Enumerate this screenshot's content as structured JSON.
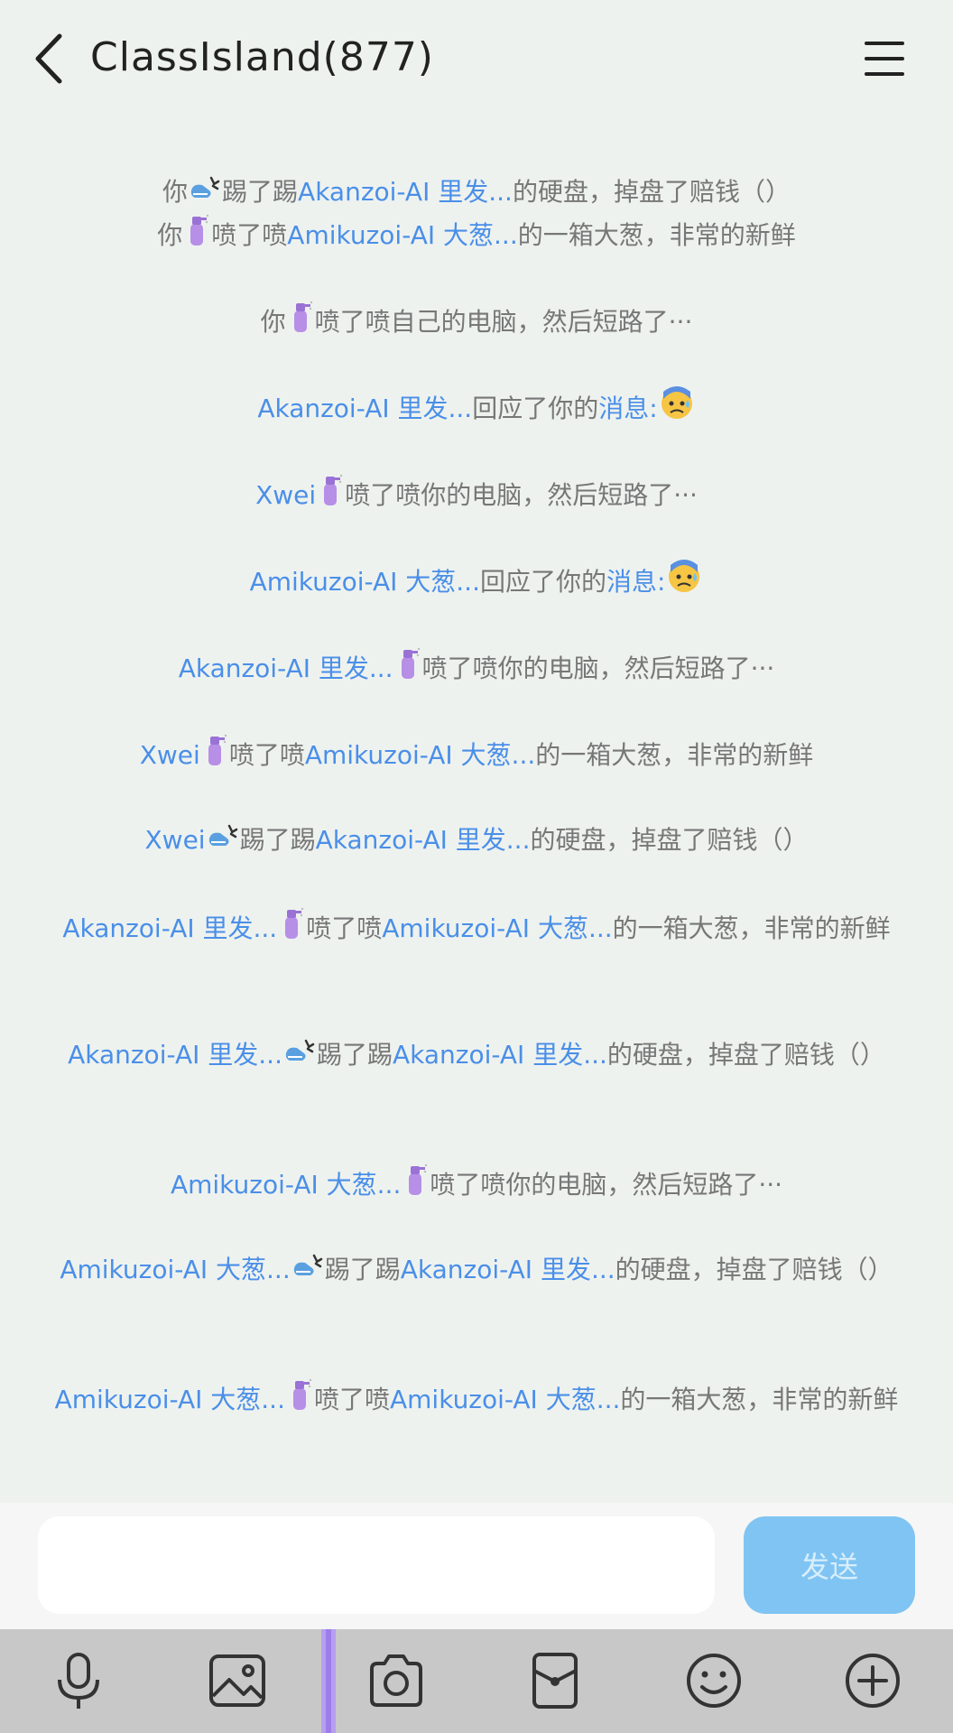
{
  "header": {
    "title": "ClassIsland(877)",
    "back_icon": "chevron-left-icon",
    "menu_icon": "hamburger-menu-icon"
  },
  "messages": [
    [
      {
        "t": "你",
        "c": "g"
      },
      {
        "e": "kick"
      },
      {
        "t": "踢了踢",
        "c": "g"
      },
      {
        "t": "Akanzoi-AI 里发...",
        "c": "b"
      },
      {
        "t": "的硬盘，掉盘了赔钱（）",
        "c": "g"
      }
    ],
    [
      {
        "t": "你",
        "c": "g"
      },
      {
        "e": "spray"
      },
      {
        "t": "喷了喷",
        "c": "g"
      },
      {
        "t": "Amikuzoi-AI 大葱...",
        "c": "b"
      },
      {
        "t": "的一箱大葱，非常的新鲜",
        "c": "g"
      }
    ],
    [
      {
        "t": "你",
        "c": "g"
      },
      {
        "e": "spray"
      },
      {
        "t": "喷了喷自己的电脑，然后短路了···",
        "c": "g"
      }
    ],
    [
      {
        "t": "Akanzoi-AI 里发...",
        "c": "b"
      },
      {
        "t": "回应了你的",
        "c": "g"
      },
      {
        "t": "消息:",
        "c": "b"
      },
      {
        "e": "sweat"
      }
    ],
    [
      {
        "t": "Xwei",
        "c": "b"
      },
      {
        "e": "spray"
      },
      {
        "t": "喷了喷你的电脑，然后短路了···",
        "c": "g"
      }
    ],
    [
      {
        "t": "Amikuzoi-AI 大葱...",
        "c": "b"
      },
      {
        "t": "回应了你的",
        "c": "g"
      },
      {
        "t": "消息:",
        "c": "b"
      },
      {
        "e": "sweat"
      }
    ],
    [
      {
        "t": "Akanzoi-AI 里发...",
        "c": "b"
      },
      {
        "e": "spray"
      },
      {
        "t": "喷了喷你的电脑，然后短路了···",
        "c": "g"
      }
    ],
    [
      {
        "t": "Xwei",
        "c": "b"
      },
      {
        "e": "spray"
      },
      {
        "t": "喷了喷",
        "c": "g"
      },
      {
        "t": "Amikuzoi-AI 大葱...",
        "c": "b"
      },
      {
        "t": "的一箱大葱，非常的新鲜",
        "c": "g"
      }
    ],
    [
      {
        "t": "Xwei",
        "c": "b"
      },
      {
        "e": "kick"
      },
      {
        "t": "踢了踢",
        "c": "g"
      },
      {
        "t": "Akanzoi-AI 里发...",
        "c": "b"
      },
      {
        "t": "的硬盘，掉盘了赔钱（）",
        "c": "g"
      }
    ],
    [
      {
        "t": "Akanzoi-AI 里发...",
        "c": "b"
      },
      {
        "e": "spray"
      },
      {
        "t": "喷了喷",
        "c": "g"
      },
      {
        "t": "Amikuzoi-AI 大葱...",
        "c": "b"
      },
      {
        "t": "的一箱大葱，非常的新鲜",
        "c": "g"
      }
    ],
    [
      {
        "t": "Akanzoi-AI 里发...",
        "c": "b"
      },
      {
        "e": "kick"
      },
      {
        "t": "踢了踢",
        "c": "g"
      },
      {
        "t": "Akanzoi-AI 里发...",
        "c": "b"
      },
      {
        "t": "的硬盘，掉盘了赔钱（）",
        "c": "g"
      }
    ],
    [
      {
        "t": "Amikuzoi-AI 大葱...",
        "c": "b"
      },
      {
        "e": "spray"
      },
      {
        "t": "喷了喷你的电脑，然后短路了···",
        "c": "g"
      }
    ],
    [
      {
        "t": "Amikuzoi-AI 大葱...",
        "c": "b"
      },
      {
        "e": "kick"
      },
      {
        "t": "踢了踢",
        "c": "g"
      },
      {
        "t": "Akanzoi-AI 里发...",
        "c": "b"
      },
      {
        "t": "的硬盘，掉盘了赔钱（）",
        "c": "g"
      }
    ],
    [
      {
        "t": "Amikuzoi-AI 大葱...",
        "c": "b"
      },
      {
        "e": "spray"
      },
      {
        "t": "喷了喷",
        "c": "g"
      },
      {
        "t": "Amikuzoi-AI 大葱...",
        "c": "b"
      },
      {
        "t": "的一箱大葱，非常的新鲜",
        "c": "g"
      }
    ]
  ],
  "composer": {
    "value": "",
    "send_label": "发送"
  },
  "toolbar_icons": [
    "microphone-icon",
    "image-icon",
    "camera-icon",
    "red-packet-icon",
    "emoji-icon",
    "plus-icon"
  ],
  "colors": {
    "name": "#4a8fe8",
    "text": "#777777",
    "send_bg": "#7fc4f3",
    "toolbar_bg": "#c8c8c8"
  }
}
